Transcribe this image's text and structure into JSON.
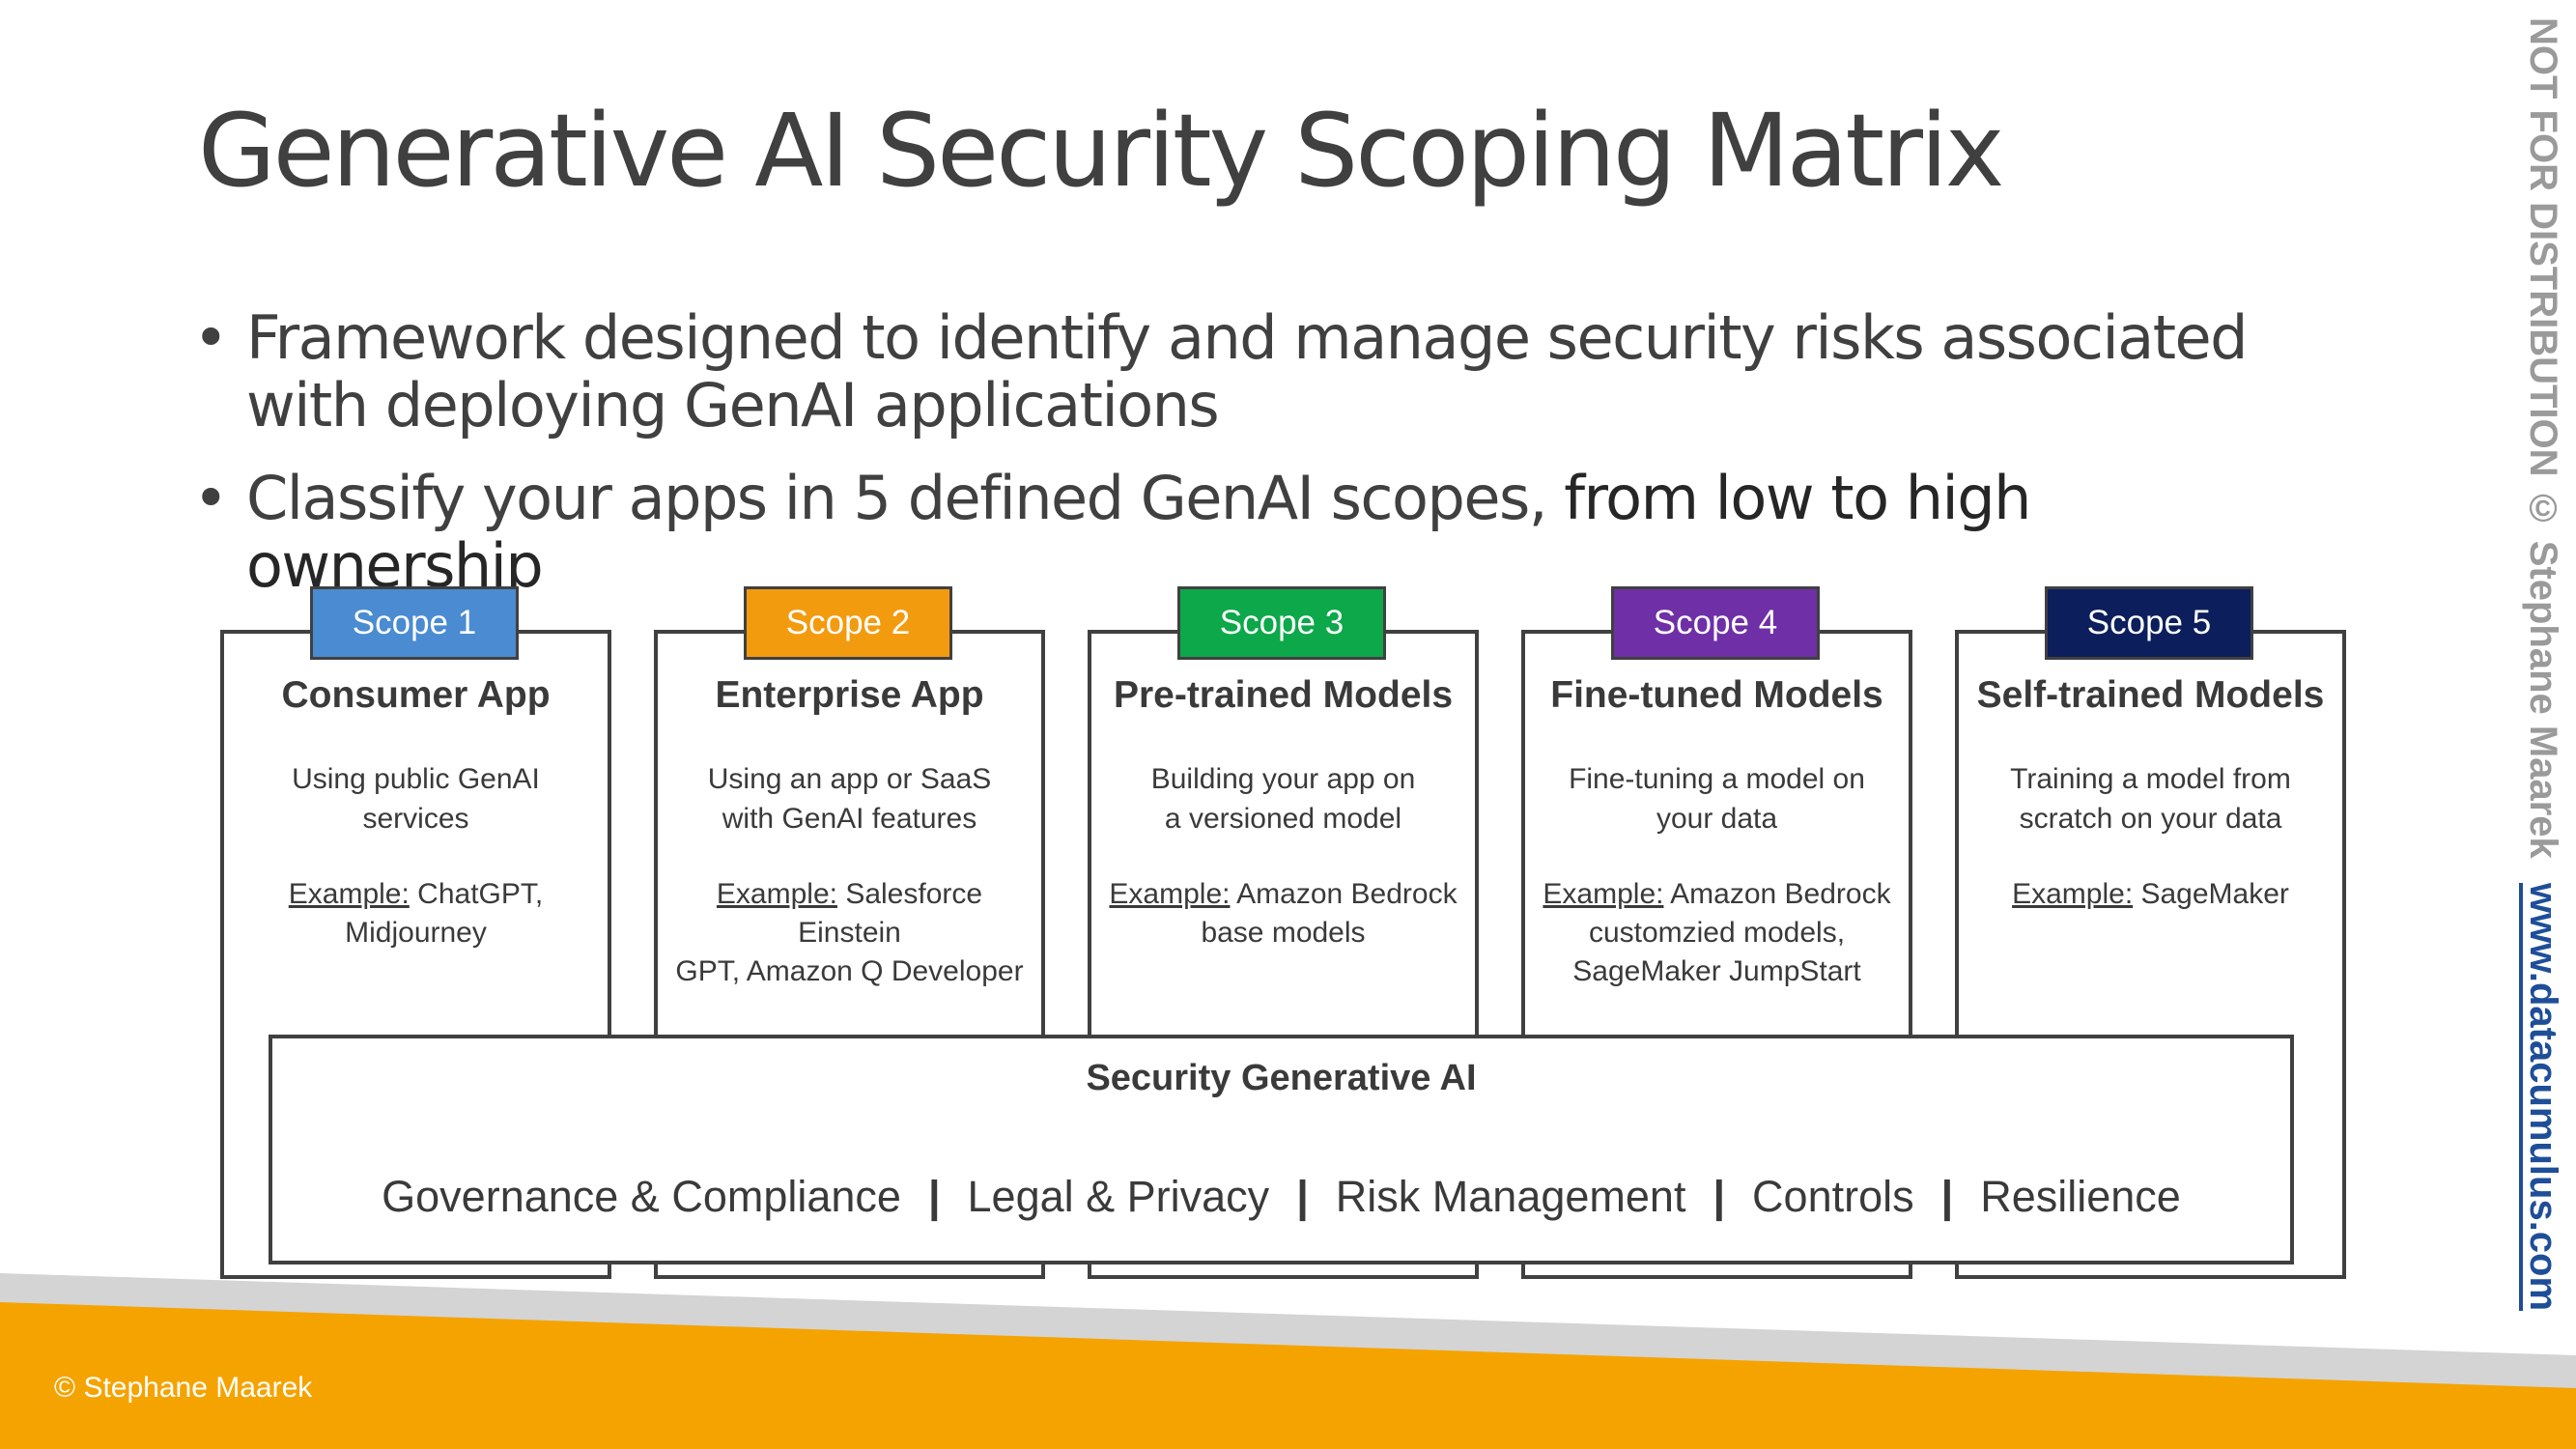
{
  "title": "Generative AI Security Scoping Matrix",
  "bullets": [
    {
      "text": "Framework designed to identify and manage security risks associated with deploying GenAI applications"
    },
    {
      "text": "Classify your apps in 5 defined GenAI scopes, ",
      "strong": "from low to high ownership"
    }
  ],
  "bullet_glyph": "•",
  "scopes": [
    {
      "tab": "Scope 1",
      "color": "#4a8bd1",
      "title": "Consumer App",
      "desc_1": "Using public GenAI",
      "desc_2": "services",
      "ex_label": "Example:",
      "ex_1": " ChatGPT,",
      "ex_2": "Midjourney",
      "ex_3": ""
    },
    {
      "tab": "Scope 2",
      "color": "#f39b0f",
      "title": "Enterprise App",
      "desc_1": "Using an app or SaaS",
      "desc_2": "with GenAI features",
      "ex_label": "Example:",
      "ex_1": " Salesforce Einstein",
      "ex_2": "GPT, Amazon Q Developer",
      "ex_3": ""
    },
    {
      "tab": "Scope 3",
      "color": "#0ca84a",
      "title": "Pre-trained Models",
      "desc_1": "Building your app on",
      "desc_2": "a versioned model",
      "ex_label": "Example:",
      "ex_1": " Amazon Bedrock",
      "ex_2": "base models",
      "ex_3": ""
    },
    {
      "tab": "Scope 4",
      "color": "#6f2fa6",
      "title": "Fine-tuned Models",
      "desc_1": "Fine-tuning a model on",
      "desc_2": "your data",
      "ex_label": "Example:",
      "ex_1": " Amazon Bedrock",
      "ex_2": "customzied models,",
      "ex_3": "SageMaker JumpStart"
    },
    {
      "tab": "Scope 5",
      "color": "#0c1f5c",
      "title": "Self-trained Models",
      "desc_1": "Training a model from",
      "desc_2": "scratch on your data",
      "ex_label": "Example:",
      "ex_1": " SageMaker",
      "ex_2": "",
      "ex_3": ""
    }
  ],
  "security": {
    "title": "Security Generative AI",
    "items": [
      "Governance & Compliance",
      "Legal & Privacy",
      "Risk Management",
      "Controls",
      "Resilience"
    ],
    "separator": "|"
  },
  "footer": {
    "copyright": "© Stephane Maarek"
  },
  "vertical": {
    "notice": "NOT FOR DISTRIBUTION © Stephane Maarek",
    "link": "www.datacumulus.com"
  },
  "colors": {
    "stripe_gray": "#d4d4d4",
    "stripe_orange": "#f5a300"
  }
}
